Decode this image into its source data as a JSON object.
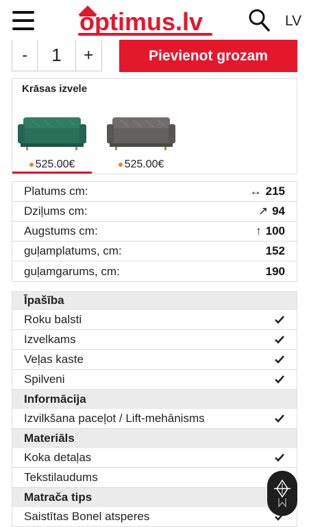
{
  "header": {
    "logo_text": "optimus.lv",
    "language": "LV",
    "menu_icon": "hamburger-icon",
    "search_icon": "search-icon"
  },
  "quantity": {
    "minus": "-",
    "value": "1",
    "plus": "+"
  },
  "cart_button": "Pievienot grozam",
  "color_select": {
    "title": "Krāsas izvele",
    "variants": [
      {
        "color": "green",
        "price": "525.00€",
        "selected": true
      },
      {
        "color": "grey",
        "price": "525.00€",
        "selected": false
      }
    ]
  },
  "dimensions": [
    {
      "label": "Platums cm:",
      "icon": "↔",
      "value": "215"
    },
    {
      "label": "Dziļums cm:",
      "icon": "↗",
      "value": "94"
    },
    {
      "label": "Augstums cm:",
      "icon": "↑",
      "value": "100"
    },
    {
      "label": "guļamplatums, cm:",
      "icon": "",
      "value": "152"
    },
    {
      "label": "guļamgarums, cm:",
      "icon": "",
      "value": "190"
    }
  ],
  "properties": {
    "feature_title": "Īpašība",
    "features": [
      "Roku balsti",
      "Izvelkams",
      "Veļas kaste",
      "Spilveni"
    ],
    "info_title": "Informācija",
    "info": [
      "Izvilkšana paceļot / Lift-mehānisms"
    ],
    "material_title": "Materiāls",
    "materials": [
      "Koka detaļas",
      "Tekstilaudums"
    ],
    "mattress_title": "Matrača tips",
    "mattress": [
      "Saistītas Bonel atsperes"
    ]
  },
  "colors": {
    "brand_red": "#e4172b",
    "price_dot": "#e08a1e",
    "section_bg": "#ebebeb"
  }
}
